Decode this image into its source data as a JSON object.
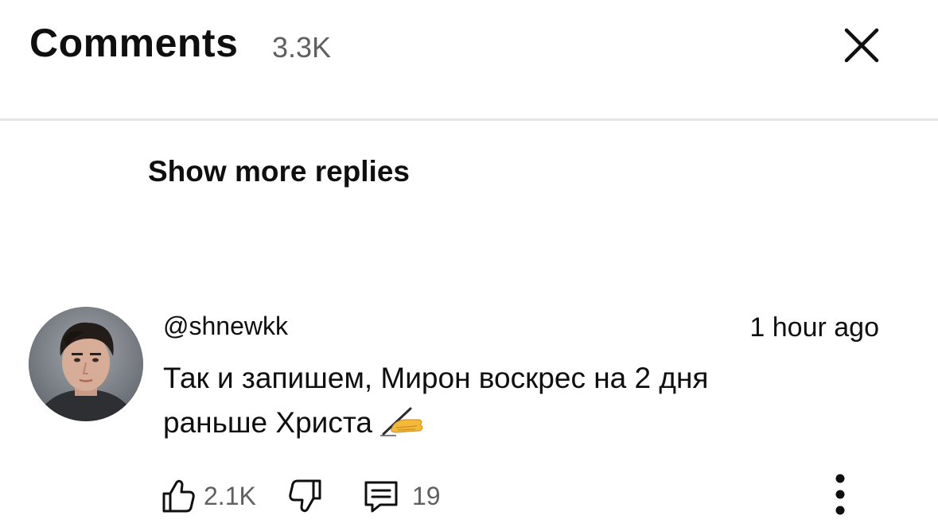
{
  "header": {
    "title": "Comments",
    "count": "3.3K"
  },
  "thread": {
    "show_more_label": "Show more replies"
  },
  "comment": {
    "author": "@shnewkk",
    "time": "1 hour ago",
    "text_line1": "Так и запишем, Мирон воскрес на 2 дня",
    "text_line2": "раньше Христа",
    "emoji": "writing-hand",
    "likes": "2.1K",
    "replies": "19"
  },
  "icons": {
    "close": "close-icon",
    "like": "thumbs-up-icon",
    "dislike": "thumbs-down-icon",
    "reply": "reply-icon",
    "more": "more-vertical-icon"
  },
  "colors": {
    "text_primary": "#0f0f0f",
    "text_secondary": "#606060",
    "divider": "#e5e5e5",
    "emoji_skin": "#f4b93b"
  }
}
